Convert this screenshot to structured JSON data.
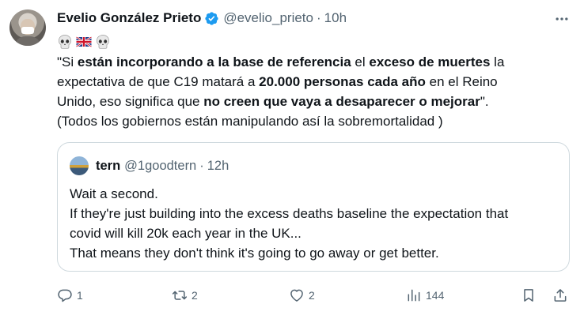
{
  "author": {
    "name": "Evelio González Prieto",
    "handle": "@evelio_prieto",
    "separator": "·",
    "time": "10h"
  },
  "icons": {
    "verified": "verified-badge-icon",
    "more": "more-options-icon",
    "skull": "skull-emoji",
    "flag": "uk-flag-emoji",
    "reply": "reply-icon",
    "repost": "repost-icon",
    "like": "heart-icon",
    "views": "views-icon",
    "bookmark": "bookmark-icon",
    "share": "share-icon"
  },
  "colors": {
    "verified": "#1d9bf0",
    "text": "#0f1419",
    "secondary": "#536471",
    "border": "#cfd9de"
  },
  "tweet": {
    "l1_a": "\"Si ",
    "l1_b": "están incorporando a la base de referencia",
    "l1_c": " el ",
    "l1_d": "exceso de muertes",
    "l1_e": " la",
    "l2_a": "expectativa de que C19 matará a ",
    "l2_b": "20.000 personas cada año",
    "l2_c": " en el Reino",
    "l3_a": "Unido, eso significa que ",
    "l3_b": "no creen que vaya a desaparecer o mejorar",
    "l3_c": "\".",
    "l4": "(Todos los gobiernos están manipulando así la sobremortalidad )"
  },
  "quote": {
    "name": "tern",
    "handle": "@1goodtern",
    "separator": "·",
    "time": "12h",
    "lines": [
      "Wait a second.",
      "If they're just building into the excess deaths baseline the expectation that",
      "covid will kill 20k each year in the UK...",
      "That means they don't think it's going to go away or get better."
    ]
  },
  "actions": {
    "replies": "1",
    "reposts": "2",
    "likes": "2",
    "views": "144"
  }
}
